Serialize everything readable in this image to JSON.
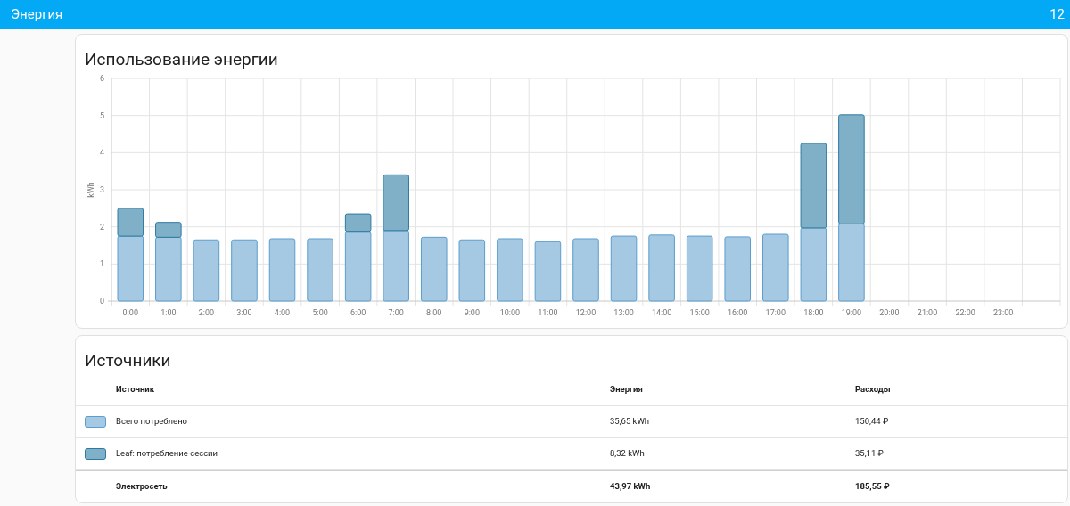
{
  "header": {
    "title": "Энергия",
    "date": "12"
  },
  "usage_card": {
    "title": "Использование энергии",
    "chart_data": {
      "type": "bar",
      "stacked": true,
      "grid": true,
      "ylabel": "kWh",
      "ylim": [
        0,
        6
      ],
      "yticks": [
        0,
        1,
        2,
        3,
        4,
        5,
        6
      ],
      "categories": [
        "0:00",
        "1:00",
        "2:00",
        "3:00",
        "4:00",
        "5:00",
        "6:00",
        "7:00",
        "8:00",
        "9:00",
        "10:00",
        "11:00",
        "12:00",
        "13:00",
        "14:00",
        "15:00",
        "16:00",
        "17:00",
        "18:00",
        "19:00",
        "20:00",
        "21:00",
        "22:00",
        "23:00"
      ],
      "series": [
        {
          "color": "#a5c8e3",
          "values": [
            1.75,
            1.72,
            1.65,
            1.65,
            1.68,
            1.68,
            1.88,
            1.9,
            1.72,
            1.65,
            1.68,
            1.6,
            1.68,
            1.75,
            1.78,
            1.75,
            1.73,
            1.8,
            1.97,
            2.08,
            null,
            null,
            null,
            null
          ]
        },
        {
          "color": "#80b0c8",
          "values": [
            0.75,
            0.4,
            0,
            0,
            0,
            0,
            0.47,
            1.5,
            0,
            0,
            0,
            0,
            0,
            0,
            0,
            0,
            0,
            0,
            2.28,
            2.94,
            null,
            null,
            null,
            null
          ]
        }
      ]
    }
  },
  "sources_card": {
    "title": "Источники",
    "columns": [
      "Источник",
      "Энергия",
      "Расходы"
    ],
    "rows": [
      {
        "color": "#a5c8e3",
        "source": "Всего потреблено",
        "energy": "35,65 kWh",
        "cost": "150,44 ₽"
      },
      {
        "color": "#80b0c8",
        "source": "Leaf: потребление сессии",
        "energy": "8,32 kWh",
        "cost": "35,11 ₽"
      }
    ],
    "total": {
      "source": "Электросеть",
      "energy": "43,97 kWh",
      "cost": "185,55 ₽"
    }
  }
}
